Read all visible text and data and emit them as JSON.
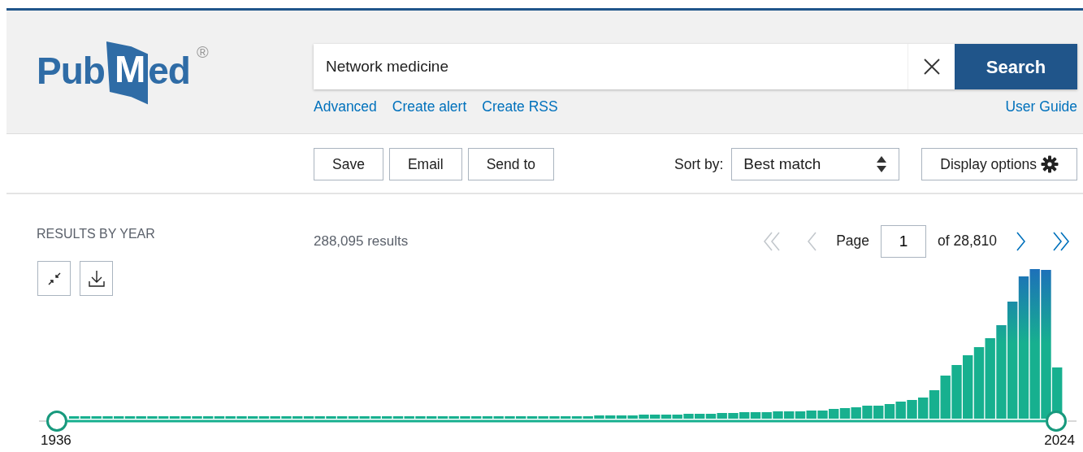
{
  "logo": {
    "parts": [
      "Pub",
      "M",
      "ed"
    ],
    "mark": "®"
  },
  "search": {
    "value": "Network medicine",
    "button": "Search"
  },
  "search_links": [
    "Advanced",
    "Create alert",
    "Create RSS"
  ],
  "user_guide": "User Guide",
  "actions": [
    "Save",
    "Email",
    "Send to"
  ],
  "sort": {
    "label": "Sort by:",
    "value": "Best match"
  },
  "display_options": "Display options",
  "results_by_year": {
    "title": "RESULTS BY YEAR",
    "start_year": "1936",
    "end_year": "2024"
  },
  "results_count": "288,095 results",
  "pagination": {
    "label": "Page",
    "value": "1",
    "total": "of 28,810",
    "buttons": [
      {
        "kind": "first",
        "disabled": true
      },
      {
        "kind": "prev",
        "disabled": true
      },
      {
        "kind": "next",
        "disabled": false
      },
      {
        "kind": "last",
        "disabled": false
      }
    ]
  }
}
